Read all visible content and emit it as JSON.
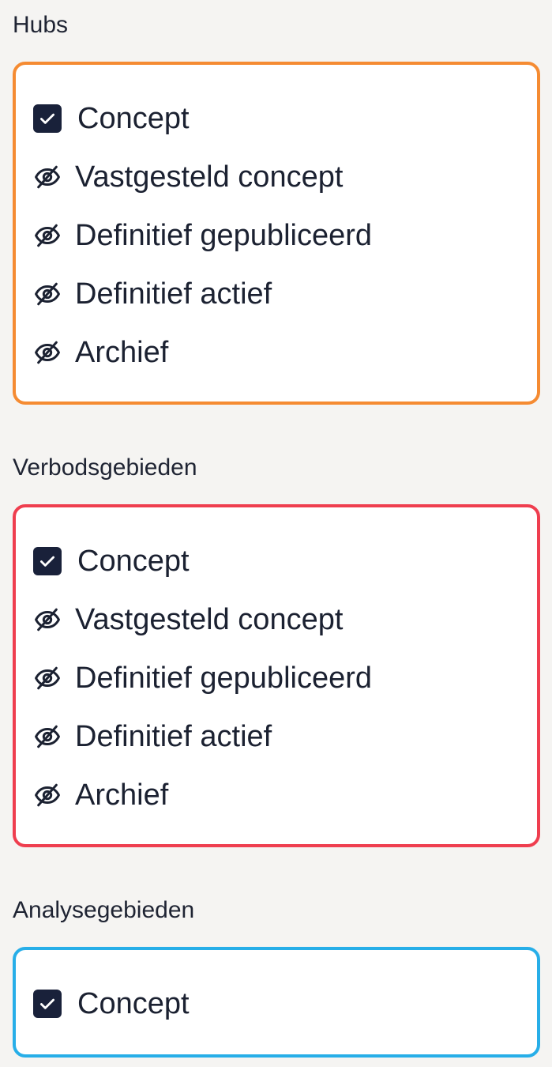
{
  "sections": [
    {
      "title": "Hubs",
      "border_color": "#f58b32",
      "items": [
        {
          "label": "Concept",
          "state": "checked",
          "icon": "check-icon"
        },
        {
          "label": "Vastgesteld concept",
          "state": "hidden",
          "icon": "eye-off-icon"
        },
        {
          "label": "Definitief gepubliceerd",
          "state": "hidden",
          "icon": "eye-off-icon"
        },
        {
          "label": "Definitief actief",
          "state": "hidden",
          "icon": "eye-off-icon"
        },
        {
          "label": "Archief",
          "state": "hidden",
          "icon": "eye-off-icon"
        }
      ]
    },
    {
      "title": "Verbodsgebieden",
      "border_color": "#ef3e4f",
      "items": [
        {
          "label": "Concept",
          "state": "checked",
          "icon": "check-icon"
        },
        {
          "label": "Vastgesteld concept",
          "state": "hidden",
          "icon": "eye-off-icon"
        },
        {
          "label": "Definitief gepubliceerd",
          "state": "hidden",
          "icon": "eye-off-icon"
        },
        {
          "label": "Definitief actief",
          "state": "hidden",
          "icon": "eye-off-icon"
        },
        {
          "label": "Archief",
          "state": "hidden",
          "icon": "eye-off-icon"
        }
      ]
    },
    {
      "title": "Analysegebieden",
      "border_color": "#27aee8",
      "items": [
        {
          "label": "Concept",
          "state": "checked",
          "icon": "check-icon"
        }
      ]
    }
  ]
}
